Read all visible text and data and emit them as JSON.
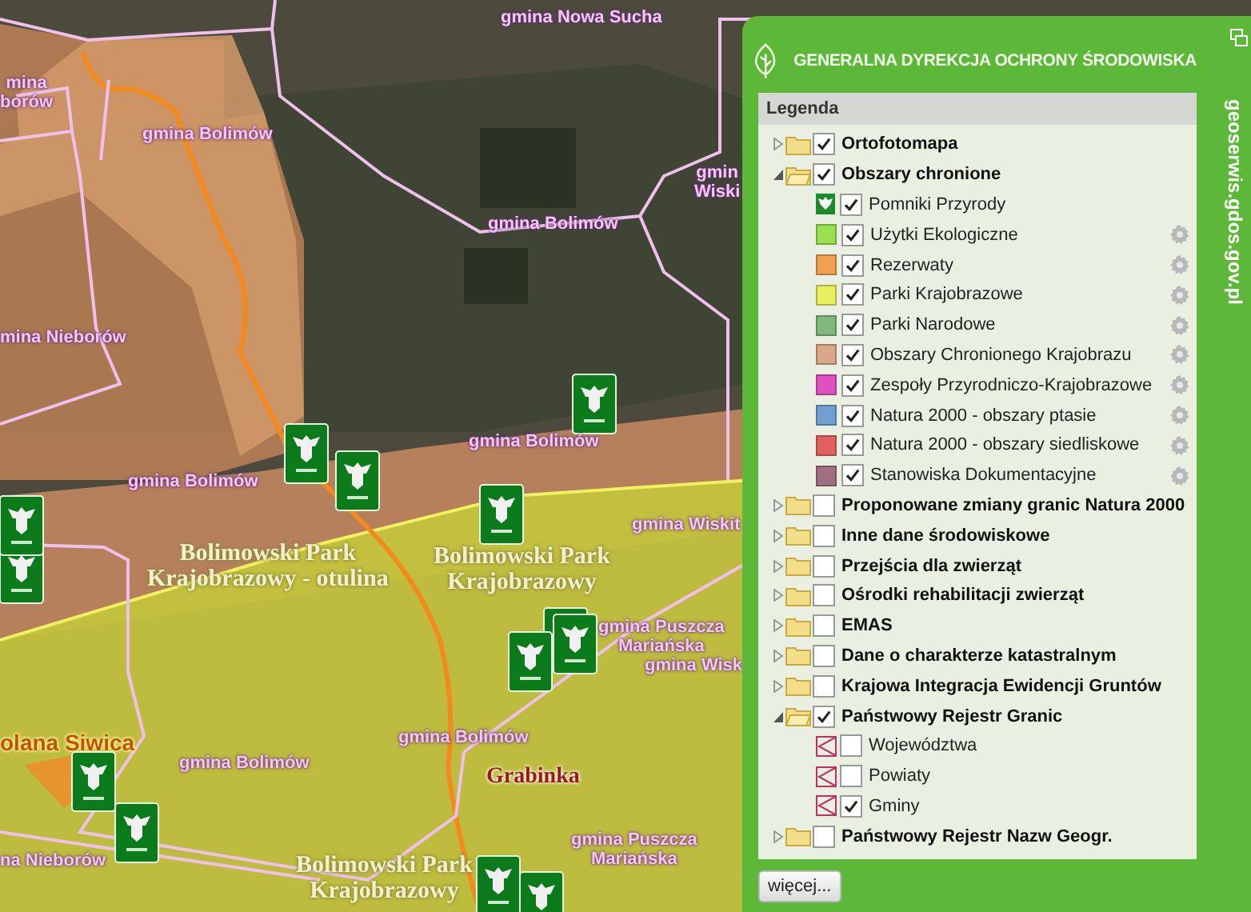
{
  "map": {
    "labels": [
      {
        "kind": "gmina",
        "text": "gmina Nowa Sucha"
      },
      {
        "kind": "gmina",
        "text": "mina\nborów"
      },
      {
        "kind": "gmina",
        "text": "gmina Bolimów"
      },
      {
        "kind": "gmina",
        "text": "gmina Bolimów"
      },
      {
        "kind": "gmina",
        "text": "gmin\nWiski"
      },
      {
        "kind": "gmina",
        "text": "mina Nieborów"
      },
      {
        "kind": "gmina",
        "text": "gmina Bolimów"
      },
      {
        "kind": "gmina",
        "text": "gmina Bolimów"
      },
      {
        "kind": "park",
        "text": "Bolimowski Park\nKrajobrazowy - otulina"
      },
      {
        "kind": "park",
        "text": "Bolimowski Park\nKrajobrazowy"
      },
      {
        "kind": "gmina",
        "text": "gmina Wiskit"
      },
      {
        "kind": "gmina",
        "text": "gmina Puszcza\nMariańska"
      },
      {
        "kind": "gmina",
        "text": "gmina Wisk"
      },
      {
        "kind": "reserve",
        "text": "olana Siwica"
      },
      {
        "kind": "gmina",
        "text": "gmina Bolimów"
      },
      {
        "kind": "gmina",
        "text": "gmina Bolimów"
      },
      {
        "kind": "place",
        "text": "Grabinka"
      },
      {
        "kind": "gmina",
        "text": "na Nieborów"
      },
      {
        "kind": "gmina",
        "text": "gmina Puszcza\nMariańska"
      },
      {
        "kind": "park",
        "text": "Bolimowski Park\nKrajobrazowy"
      }
    ]
  },
  "panel": {
    "title": "GENERALNA DYREKCJA OCHRONY ŚRODOWISKA",
    "site": "geoserwis.gdos.gov.pl",
    "legend": {
      "title": "Legenda",
      "groups": [
        {
          "label": "Ortofotomapa",
          "expanded": false,
          "checked": true
        },
        {
          "label": "Obszary chronione",
          "expanded": true,
          "checked": true,
          "children": [
            {
              "label": "Pomniki Przyrody",
              "kind": "monument",
              "checked": true,
              "settings": false
            },
            {
              "label": "Użytki Ekologiczne",
              "kind": "fill",
              "color": "#99e050",
              "checked": true,
              "settings": true
            },
            {
              "label": "Rezerwaty",
              "kind": "fill",
              "color": "#f0a050",
              "checked": true,
              "settings": true
            },
            {
              "label": "Parki Krajobrazowe",
              "kind": "fill",
              "color": "#e8f060",
              "checked": true,
              "settings": true
            },
            {
              "label": "Parki Narodowe",
              "kind": "fill",
              "color": "#80b880",
              "checked": true,
              "settings": true
            },
            {
              "label": "Obszary Chronionego Krajobrazu",
              "kind": "fill",
              "color": "#d8a888",
              "checked": true,
              "settings": true
            },
            {
              "label": "Zespoły Przyrodniczo-Krajobrazowe",
              "kind": "fill",
              "color": "#e050c0",
              "checked": true,
              "settings": true
            },
            {
              "label": "Natura 2000 - obszary ptasie",
              "kind": "fill",
              "color": "#70a0d0",
              "checked": true,
              "settings": true
            },
            {
              "label": "Natura 2000 - obszary siedliskowe",
              "kind": "fill",
              "color": "#e06060",
              "checked": true,
              "settings": true
            },
            {
              "label": "Stanowiska Dokumentacyjne",
              "kind": "fill",
              "color": "#a07080",
              "checked": true,
              "settings": true
            }
          ]
        },
        {
          "label": "Proponowane zmiany granic Natura 2000",
          "expanded": false,
          "checked": false
        },
        {
          "label": "Inne dane środowiskowe",
          "expanded": false,
          "checked": false
        },
        {
          "label": "Przejścia dla zwierząt",
          "expanded": false,
          "checked": false
        },
        {
          "label": "Ośrodki rehabilitacji zwierząt",
          "expanded": false,
          "checked": false
        },
        {
          "label": "EMAS",
          "expanded": false,
          "checked": false
        },
        {
          "label": "Dane o charakterze katastralnym",
          "expanded": false,
          "checked": false
        },
        {
          "label": "Krajowa Integracja Ewidencji Gruntów",
          "expanded": false,
          "checked": false
        },
        {
          "label": "Państwowy Rejestr Granic",
          "expanded": true,
          "checked": true,
          "children": [
            {
              "label": "Województwa",
              "kind": "boundary",
              "checked": false,
              "settings": false
            },
            {
              "label": "Powiaty",
              "kind": "boundary",
              "checked": false,
              "settings": false
            },
            {
              "label": "Gminy",
              "kind": "boundary",
              "checked": true,
              "settings": false
            }
          ]
        },
        {
          "label": "Państwowy Rejestr Nazw Geogr.",
          "expanded": false,
          "checked": false
        }
      ]
    },
    "more_button": "więcej..."
  }
}
